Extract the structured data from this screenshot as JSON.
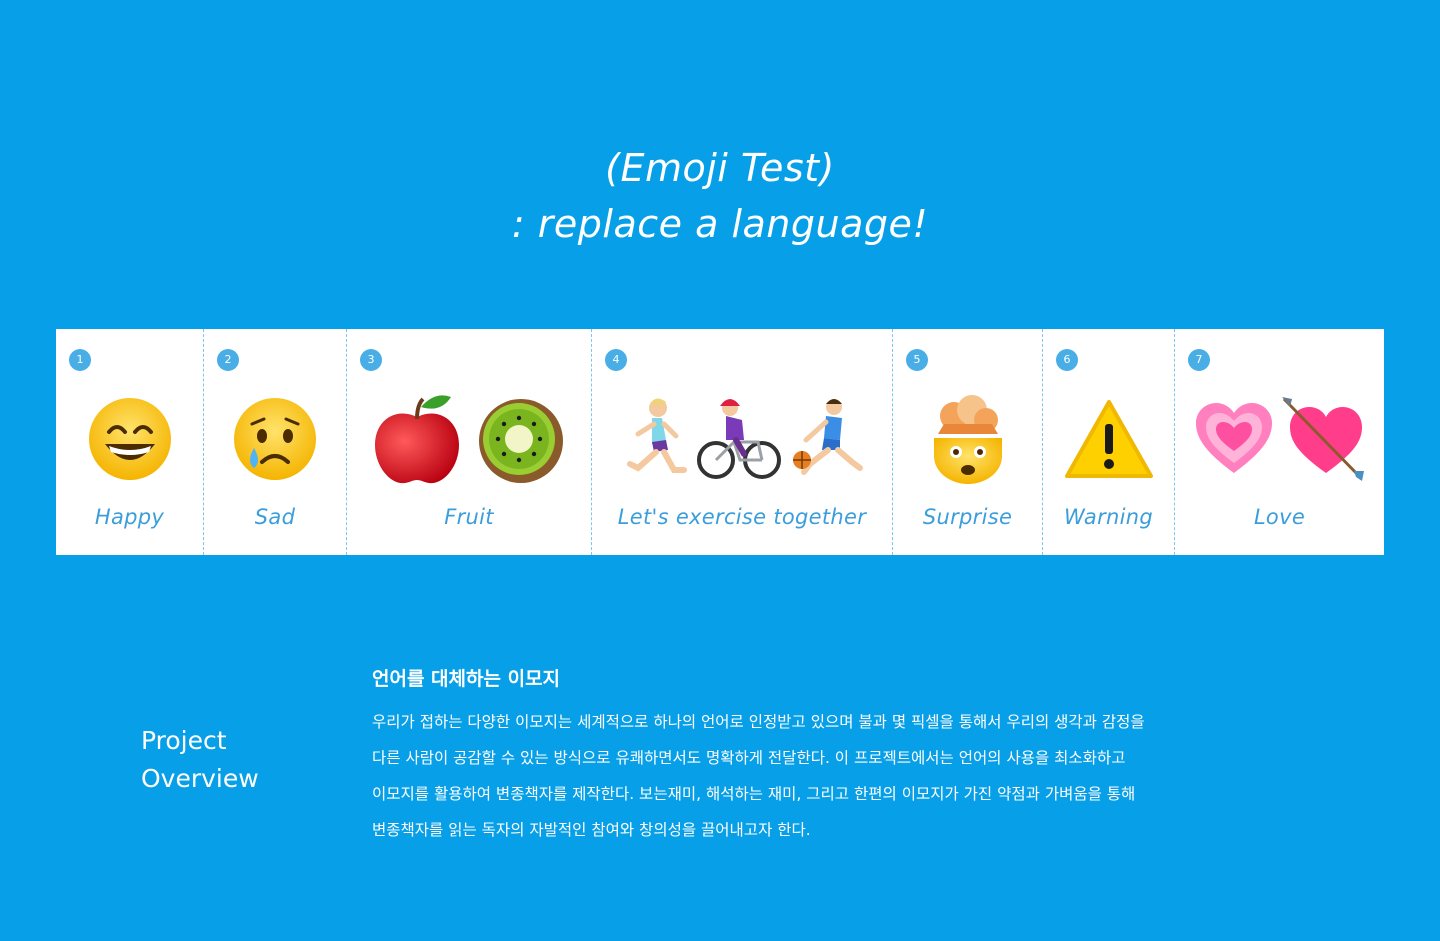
{
  "hero": {
    "line1": "(Emoji Test)",
    "line2": ": replace a language!"
  },
  "cards": [
    {
      "num": "1",
      "label": "Happy",
      "emoji": [
        "grinning-face-icon"
      ]
    },
    {
      "num": "2",
      "label": "Sad",
      "emoji": [
        "crying-face-icon"
      ]
    },
    {
      "num": "3",
      "label": "Fruit",
      "emoji": [
        "red-apple-icon",
        "kiwi-fruit-icon"
      ]
    },
    {
      "num": "4",
      "label": "Let's exercise together",
      "emoji": [
        "woman-running-icon",
        "woman-biking-icon",
        "person-bouncing-ball-icon"
      ]
    },
    {
      "num": "5",
      "label": "Surprise",
      "emoji": [
        "exploding-head-icon"
      ]
    },
    {
      "num": "6",
      "label": "Warning",
      "emoji": [
        "warning-sign-icon"
      ]
    },
    {
      "num": "7",
      "label": "Love",
      "emoji": [
        "growing-heart-icon",
        "heart-with-arrow-icon"
      ]
    }
  ],
  "overview": {
    "heading_line1": "Project",
    "heading_line2": "Overview",
    "title": "언어를 대체하는 이모지",
    "lines": [
      "우리가 접하는 다양한 이모지는 세계적으로 하나의 언어로 인정받고 있으며 불과 몇 픽셀을 통해서 우리의 생각과 감정을",
      "다른 사람이 공감할 수 있는 방식으로 유쾌하면서도 명확하게 전달한다. 이 프로젝트에서는 언어의 사용을 최소화하고",
      "이모지를 활용하여 변종책자를 제작한다. 보는재미, 해석하는 재미, 그리고 한편의 이모지가 가진 약점과 가벼움을 통해",
      "변종책자를 읽는 독자의 자발적인 참여와 창의성을 끌어내고자 한다."
    ]
  },
  "colors": {
    "background": "#07a0e8",
    "label": "#3b9edb",
    "badge": "#4aaee6"
  }
}
